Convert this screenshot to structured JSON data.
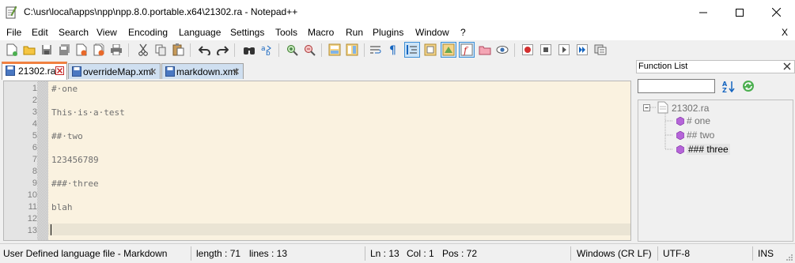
{
  "window": {
    "title": "C:\\usr\\local\\apps\\npp\\npp.8.0.portable.x64\\21302.ra - Notepad++",
    "minimize_glyph": "—",
    "maximize_glyph": "☐",
    "close_glyph": "✕"
  },
  "menu": {
    "items": [
      "File",
      "Edit",
      "Search",
      "View",
      "Encoding",
      "Language",
      "Settings",
      "Tools",
      "Macro",
      "Run",
      "Plugins",
      "Window",
      "?"
    ],
    "close_label": "X"
  },
  "toolbar": {
    "buttons": [
      "new-file-icon",
      "open-file-icon",
      "save-icon",
      "save-all-icon",
      "close-icon",
      "close-all-icon",
      "print-icon",
      "cut-icon",
      "copy-icon",
      "paste-icon",
      "undo-icon",
      "redo-icon",
      "find-icon",
      "replace-icon",
      "zoom-in-icon",
      "zoom-out-icon",
      "sync-vertical-icon",
      "sync-horizontal-icon",
      "word-wrap-icon",
      "show-all-chars-icon",
      "indent-guide-icon",
      "language-icon",
      "document-map-icon",
      "function-list-icon",
      "folder-workspace-icon",
      "monitoring-icon",
      "record-macro-icon",
      "stop-macro-icon",
      "play-macro-icon",
      "run-macro-multiple-icon",
      "save-macro-icon"
    ]
  },
  "tabs": [
    {
      "label": "21302.ra",
      "active": true
    },
    {
      "label": "overrideMap.xml",
      "active": false
    },
    {
      "label": "markdown.xml",
      "active": false
    }
  ],
  "editor": {
    "line_numbers": [
      "1",
      "2",
      "3",
      "4",
      "5",
      "6",
      "7",
      "8",
      "9",
      "10",
      "11",
      "12",
      "13"
    ],
    "lines": [
      "#·one",
      "",
      "This·is·a·test",
      "",
      "##·two",
      "",
      "123456789",
      "",
      "###·three",
      "",
      "blah",
      "",
      ""
    ],
    "current_line": 13
  },
  "function_list": {
    "title": "Function List",
    "search_value": "",
    "root": "21302.ra",
    "items": [
      "# one",
      "## two",
      "### three"
    ],
    "selected_index": 2
  },
  "status": {
    "language": "User Defined language file - Markdown",
    "length": "length : 71",
    "lines": "lines : 13",
    "ln": "Ln : 13",
    "col": "Col : 1",
    "pos": "Pos : 72",
    "eol": "Windows (CR LF)",
    "encoding": "UTF-8",
    "mode": "INS"
  },
  "colors": {
    "editor_bg": "#faf2e0",
    "active_tab_accent": "#f08040",
    "inactive_tab": "#cfdff0"
  }
}
